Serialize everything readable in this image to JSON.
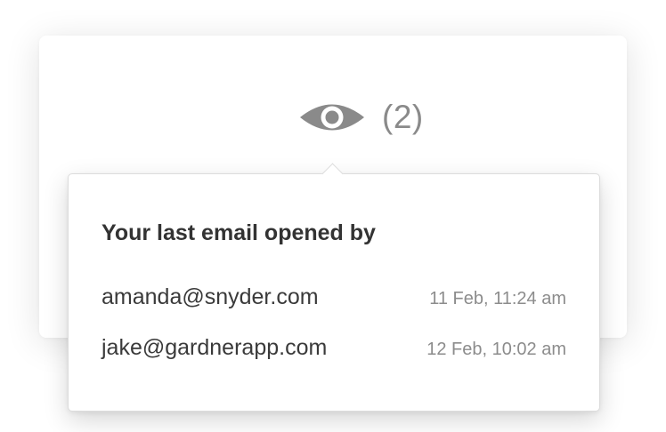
{
  "views": {
    "icon": "eye-icon",
    "count_label": "(2)"
  },
  "popover": {
    "title": "Your last email opened by",
    "entries": [
      {
        "email": "amanda@snyder.com",
        "time": "11 Feb, 11:24 am"
      },
      {
        "email": "jake@gardnerapp.com",
        "time": "12 Feb, 10:02 am"
      }
    ]
  },
  "colors": {
    "icon": "#8a8a8a",
    "text": "#333333",
    "muted": "#8c8c8c"
  }
}
